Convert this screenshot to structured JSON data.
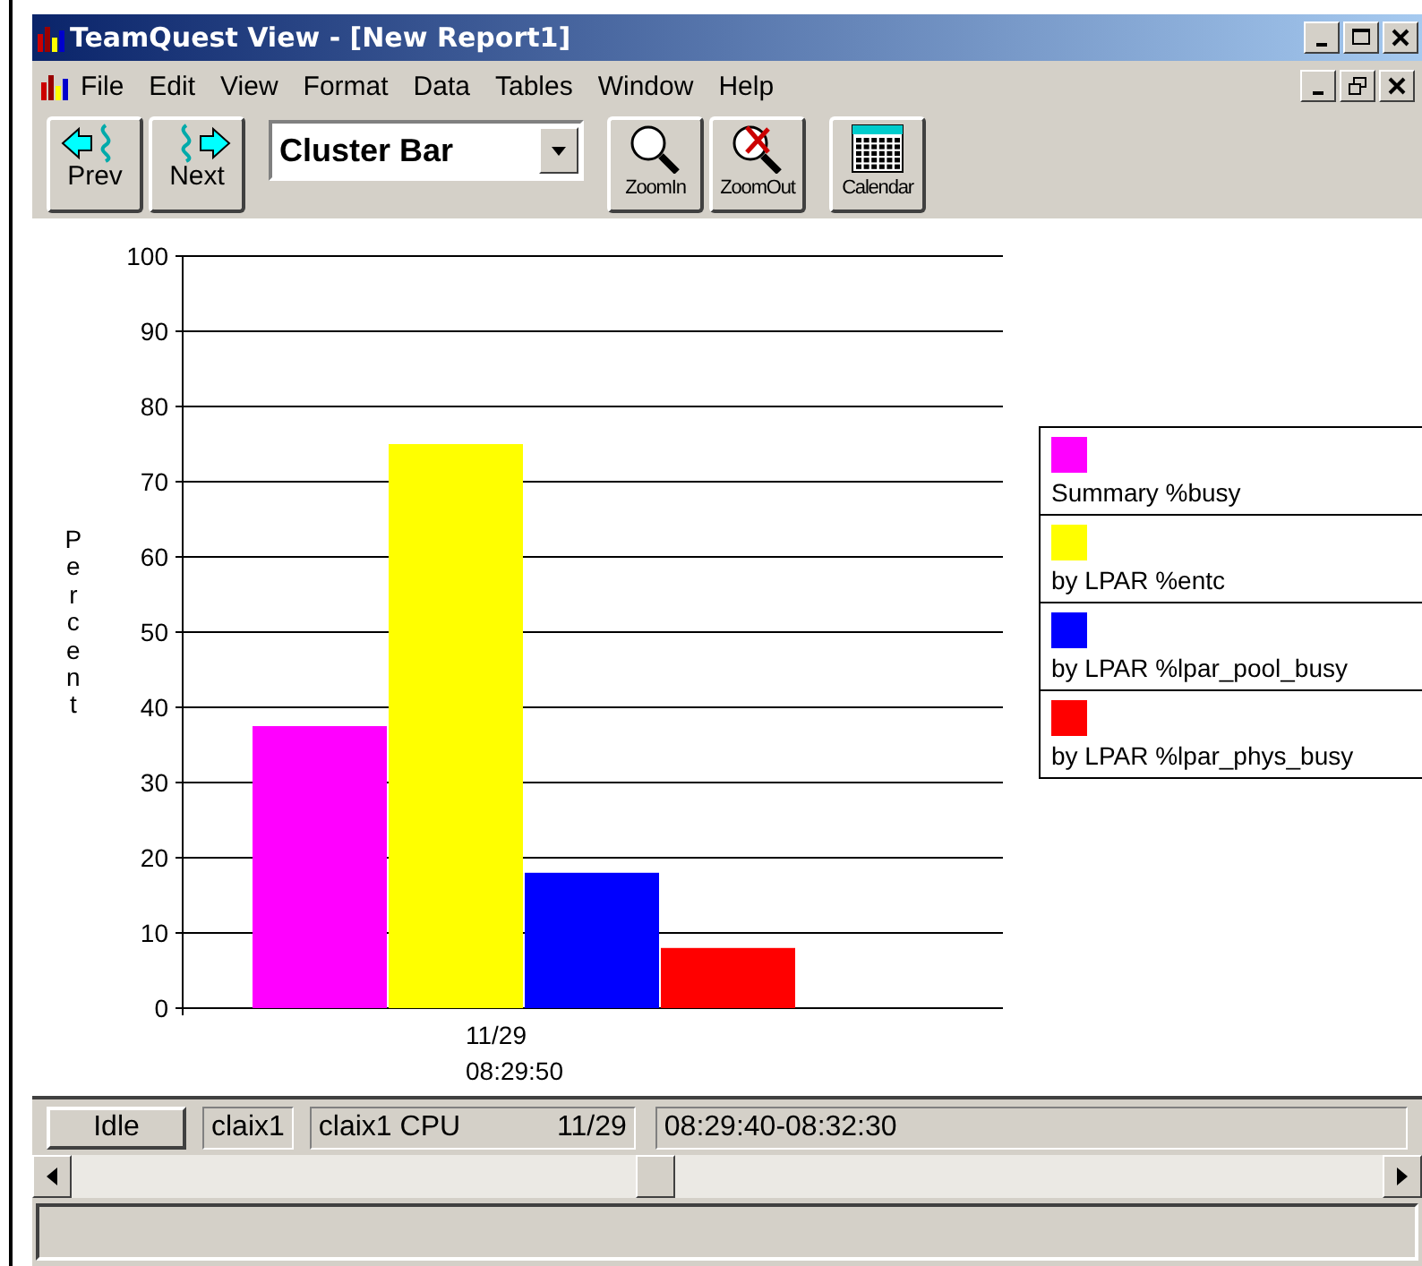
{
  "window": {
    "title": "TeamQuest View - [New Report1]"
  },
  "menu": [
    "File",
    "Edit",
    "View",
    "Format",
    "Data",
    "Tables",
    "Window",
    "Help"
  ],
  "toolbar": {
    "buttons": [
      {
        "kind": "prev",
        "label": "Prev"
      },
      {
        "kind": "next",
        "label": "Next"
      }
    ],
    "chart_type": {
      "value": "Cluster Bar"
    },
    "tools": [
      {
        "kind": "zoomin",
        "label": "ZoomIn"
      },
      {
        "kind": "zoomout",
        "label": "ZoomOut"
      },
      {
        "kind": "calendar",
        "label": "Calendar"
      }
    ]
  },
  "chart_data": {
    "type": "bar",
    "orientation": "vertical",
    "grid": true,
    "legend": "right",
    "ylabel": "Percent",
    "categories": [
      "11/29 08:29:50"
    ],
    "ylim": [
      0,
      100
    ],
    "yticks": [
      0,
      10,
      20,
      30,
      40,
      50,
      60,
      70,
      80,
      90,
      100
    ],
    "series": [
      {
        "name": "Summary %busy",
        "color": "#ff00ff",
        "values": [
          37.5
        ]
      },
      {
        "name": "by LPAR %entc",
        "color": "#ffff00",
        "values": [
          75
        ]
      },
      {
        "name": "by LPAR %lpar_pool_busy",
        "color": "#0000ff",
        "values": [
          18
        ]
      },
      {
        "name": "by LPAR %lpar_phys_busy",
        "color": "#ff0000",
        "values": [
          8
        ]
      }
    ]
  },
  "status_bar": {
    "state_button": "Idle",
    "host": "claix1",
    "metric": "claix1  CPU",
    "date": "11/29",
    "time_range": "08:29:40-08:32:30"
  }
}
